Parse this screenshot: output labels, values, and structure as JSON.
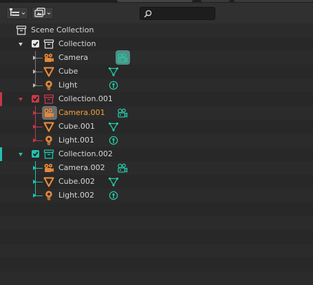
{
  "colors": {
    "background": "#282828",
    "header": "#303030",
    "collection_icon": "#d8d8d8",
    "object_icon": "#e5883a",
    "data_icon": "#27c7a6",
    "active_text": "#f1a33a",
    "collection001_color": "#c6394c",
    "collection002_color": "#22c2b0"
  },
  "header": {
    "display_mode_icon": "outliner-display-icon",
    "filter_icon": "filter-icon",
    "search": {
      "placeholder": "",
      "icon": "search-icon"
    }
  },
  "tree": {
    "scene_collection": {
      "label": "Scene Collection",
      "icon": "scene-collection-icon"
    },
    "collections": [
      {
        "label": "Collection",
        "checked": true,
        "expanded": true,
        "color": "#d8d8d8",
        "objects": [
          {
            "label": "Camera",
            "type": "camera",
            "expanded": false,
            "active": false,
            "data_icon": "camera-data-icon",
            "data_highlighted": true
          },
          {
            "label": "Cube",
            "type": "mesh",
            "expanded": false,
            "active": false,
            "data_icon": "mesh-data-icon"
          },
          {
            "label": "Light",
            "type": "light",
            "expanded": false,
            "active": false,
            "data_icon": "light-data-icon"
          }
        ]
      },
      {
        "label": "Collection.001",
        "checked": true,
        "expanded": true,
        "color": "#c6394c",
        "objects": [
          {
            "label": "Camera.001",
            "type": "camera",
            "expanded": false,
            "active": true,
            "data_icon": "camera-data-icon"
          },
          {
            "label": "Cube.001",
            "type": "mesh",
            "expanded": false,
            "active": false,
            "data_icon": "mesh-data-icon"
          },
          {
            "label": "Light.001",
            "type": "light",
            "expanded": false,
            "active": false,
            "data_icon": "light-data-icon"
          }
        ]
      },
      {
        "label": "Collection.002",
        "checked": true,
        "expanded": true,
        "color": "#22c2b0",
        "objects": [
          {
            "label": "Camera.002",
            "type": "camera",
            "expanded": false,
            "active": false,
            "data_icon": "camera-data-icon"
          },
          {
            "label": "Cube.002",
            "type": "mesh",
            "expanded": false,
            "active": false,
            "data_icon": "mesh-data-icon"
          },
          {
            "label": "Light.002",
            "type": "light",
            "expanded": false,
            "active": false,
            "data_icon": "light-data-icon"
          }
        ]
      }
    ]
  }
}
